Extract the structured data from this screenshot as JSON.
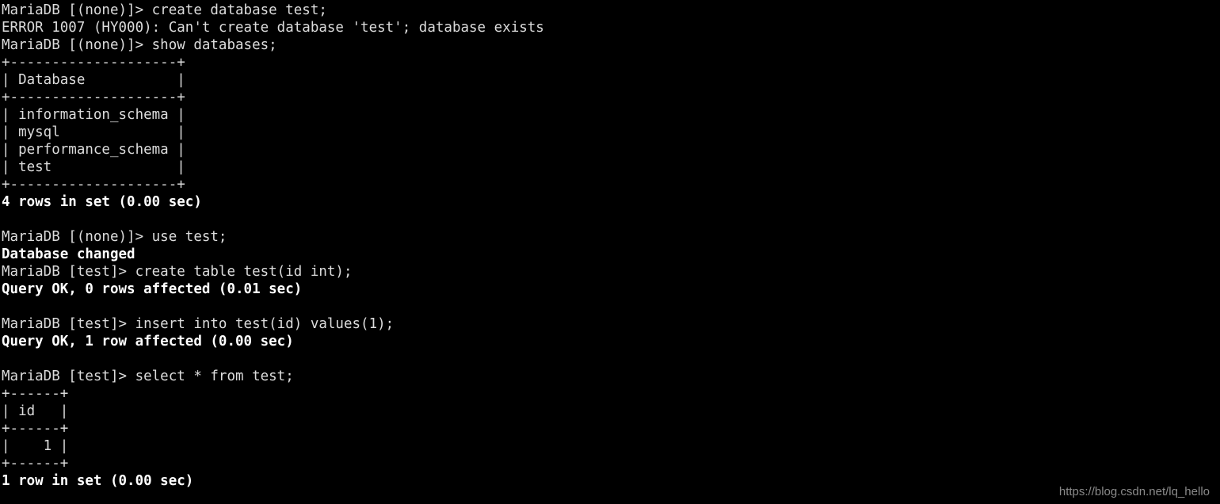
{
  "terminal": {
    "app": "MariaDB client session",
    "background_color": "#000000",
    "text_color": "#dcdcdc",
    "bold_color": "#ffffff",
    "lines": [
      {
        "kind": "cmd",
        "text": "MariaDB [(none)]> create database test;"
      },
      {
        "kind": "err",
        "text": "ERROR 1007 (HY000): Can't create database 'test'; database exists"
      },
      {
        "kind": "cmd",
        "text": "MariaDB [(none)]> show databases;"
      },
      {
        "kind": "tbl",
        "text": "+--------------------+"
      },
      {
        "kind": "tbl",
        "text": "| Database           |"
      },
      {
        "kind": "tbl",
        "text": "+--------------------+"
      },
      {
        "kind": "tbl",
        "text": "| information_schema |"
      },
      {
        "kind": "tbl",
        "text": "| mysql              |"
      },
      {
        "kind": "tbl",
        "text": "| performance_schema |"
      },
      {
        "kind": "tbl",
        "text": "| test               |"
      },
      {
        "kind": "tbl",
        "text": "+--------------------+"
      },
      {
        "kind": "out",
        "text": "4 rows in set (0.00 sec)"
      },
      {
        "kind": "blank",
        "text": " "
      },
      {
        "kind": "cmd",
        "text": "MariaDB [(none)]> use test;"
      },
      {
        "kind": "out",
        "text": "Database changed"
      },
      {
        "kind": "cmd",
        "text": "MariaDB [test]> create table test(id int);"
      },
      {
        "kind": "out",
        "text": "Query OK, 0 rows affected (0.01 sec)"
      },
      {
        "kind": "blank",
        "text": " "
      },
      {
        "kind": "cmd",
        "text": "MariaDB [test]> insert into test(id) values(1);"
      },
      {
        "kind": "out",
        "text": "Query OK, 1 row affected (0.00 sec)"
      },
      {
        "kind": "blank",
        "text": " "
      },
      {
        "kind": "cmd",
        "text": "MariaDB [test]> select * from test;"
      },
      {
        "kind": "tbl",
        "text": "+------+"
      },
      {
        "kind": "tbl",
        "text": "| id   |"
      },
      {
        "kind": "tbl",
        "text": "+------+"
      },
      {
        "kind": "tbl",
        "text": "|    1 |"
      },
      {
        "kind": "tbl",
        "text": "+------+"
      },
      {
        "kind": "out",
        "text": "1 row in set (0.00 sec)"
      }
    ]
  },
  "watermark": {
    "text": "https://blog.csdn.net/lq_hello",
    "color": "#8a8a8a"
  }
}
